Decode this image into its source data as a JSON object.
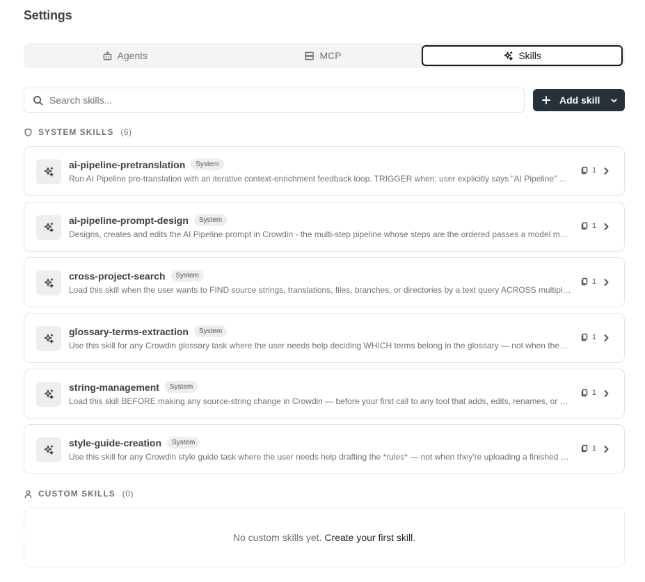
{
  "page": {
    "title": "Settings"
  },
  "tabs": [
    {
      "label": "Agents",
      "icon": "bot-icon",
      "active": false
    },
    {
      "label": "MCP",
      "icon": "server-icon",
      "active": false
    },
    {
      "label": "Skills",
      "icon": "sparkles-icon",
      "active": true
    }
  ],
  "search": {
    "placeholder": "Search skills...",
    "value": ""
  },
  "add_button": {
    "label": "Add skill"
  },
  "system_section": {
    "label": "SYSTEM SKILLS",
    "count": "(6)"
  },
  "skills": [
    {
      "name": "ai-pipeline-pretranslation",
      "badge": "System",
      "description": "Run AI Pipeline pre-translation with an iterative context-enrichment feedback loop. TRIGGER when: user explicitly says \"AI Pipeline\" pre-translate or asks to run an AI pipeline pre-translation",
      "files": "1"
    },
    {
      "name": "ai-pipeline-prompt-design",
      "badge": "System",
      "description": "Designs, creates and edits the AI Pipeline prompt in Crowdin - the multi-step pipeline whose steps are the ordered passes a model makes over each string",
      "files": "1"
    },
    {
      "name": "cross-project-search",
      "badge": "System",
      "description": "Load this skill when the user wants to FIND source strings, translations, files, branches, or directories by a text query ACROSS multiple projects",
      "files": "1"
    },
    {
      "name": "glossary-terms-extraction",
      "badge": "System",
      "description": "Use this skill for any Crowdin glossary task where the user needs help deciding WHICH terms belong in the glossary — not when they already have a list",
      "files": "1"
    },
    {
      "name": "string-management",
      "badge": "System",
      "description": "Load this skill BEFORE making any source-string change in Crowdin — before your first call to any tool that adds, edits, renames, or deletes strings",
      "files": "1"
    },
    {
      "name": "style-guide-creation",
      "badge": "System",
      "description": "Use this skill for any Crowdin style guide task where the user needs help drafting the *rules* — not when they're uploading a finished document",
      "files": "1"
    }
  ],
  "custom_section": {
    "label": "CUSTOM SKILLS",
    "count": "(0)"
  },
  "empty_state": {
    "text": "No custom skills yet.",
    "link": "Create your first skill",
    "suffix": "."
  }
}
